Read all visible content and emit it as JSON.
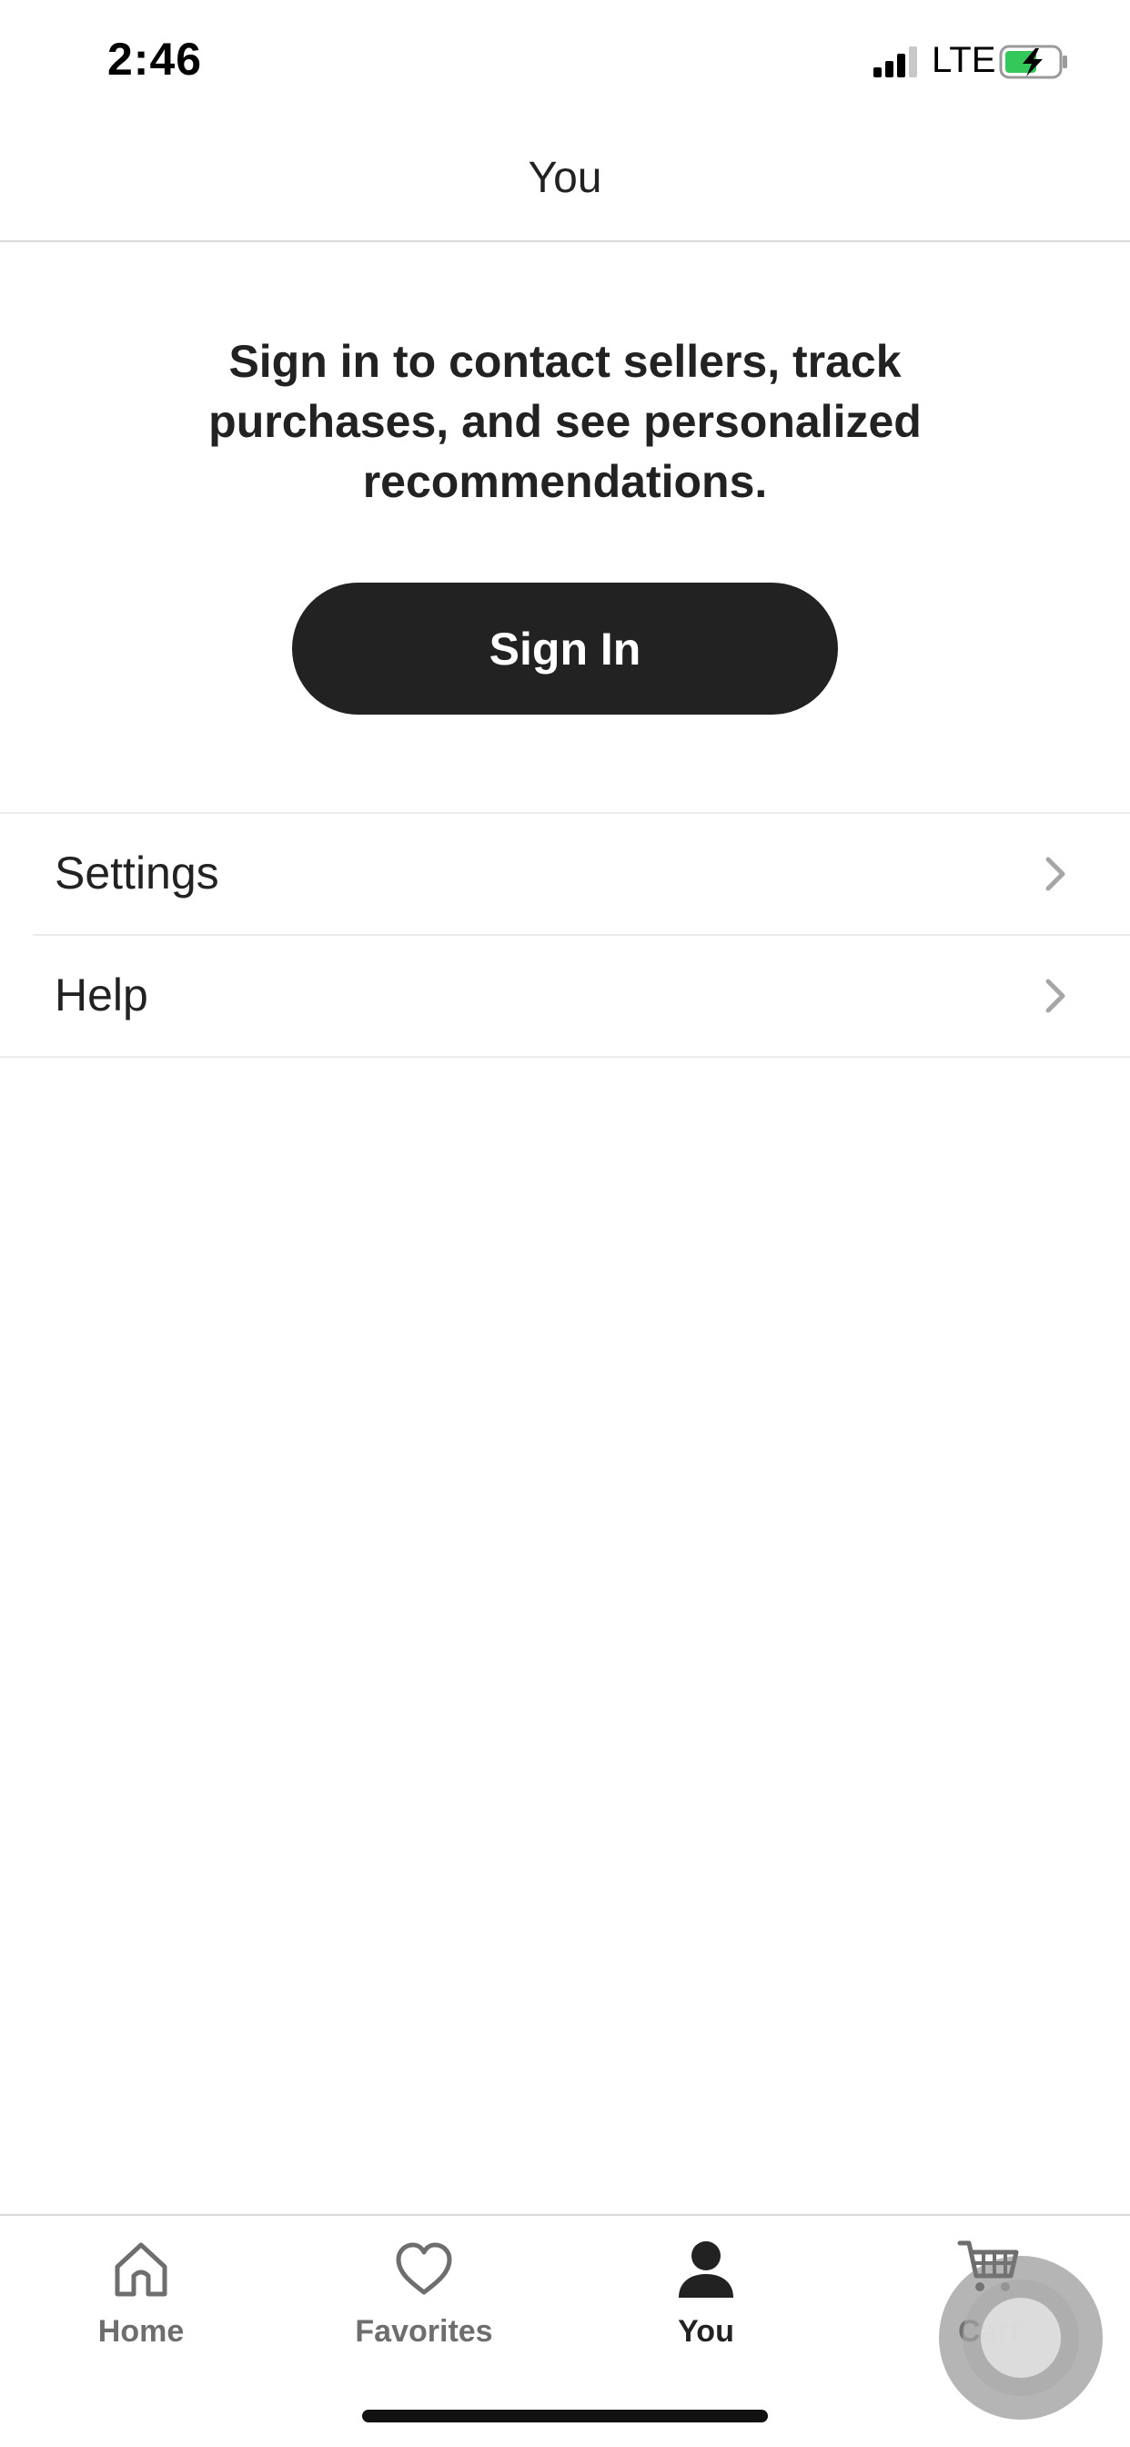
{
  "status_bar": {
    "time": "2:46",
    "network": "LTE",
    "battery_color": "#34c759",
    "battery_state": "charging"
  },
  "header": {
    "title": "You"
  },
  "main": {
    "prompt": "Sign in to contact sellers, track purchases, and see personalized recommendations.",
    "signin_label": "Sign In",
    "button_color": "#222222",
    "menu_items": [
      {
        "label": "Settings",
        "icon": "chevron-right-icon"
      },
      {
        "label": "Help",
        "icon": "chevron-right-icon"
      }
    ]
  },
  "tab_bar": {
    "items": [
      {
        "label": "Home",
        "icon": "home-icon",
        "active": false
      },
      {
        "label": "Favorites",
        "icon": "heart-icon",
        "active": false
      },
      {
        "label": "You",
        "icon": "person-icon",
        "active": true
      },
      {
        "label": "Cart",
        "icon": "cart-icon",
        "active": false
      }
    ]
  }
}
